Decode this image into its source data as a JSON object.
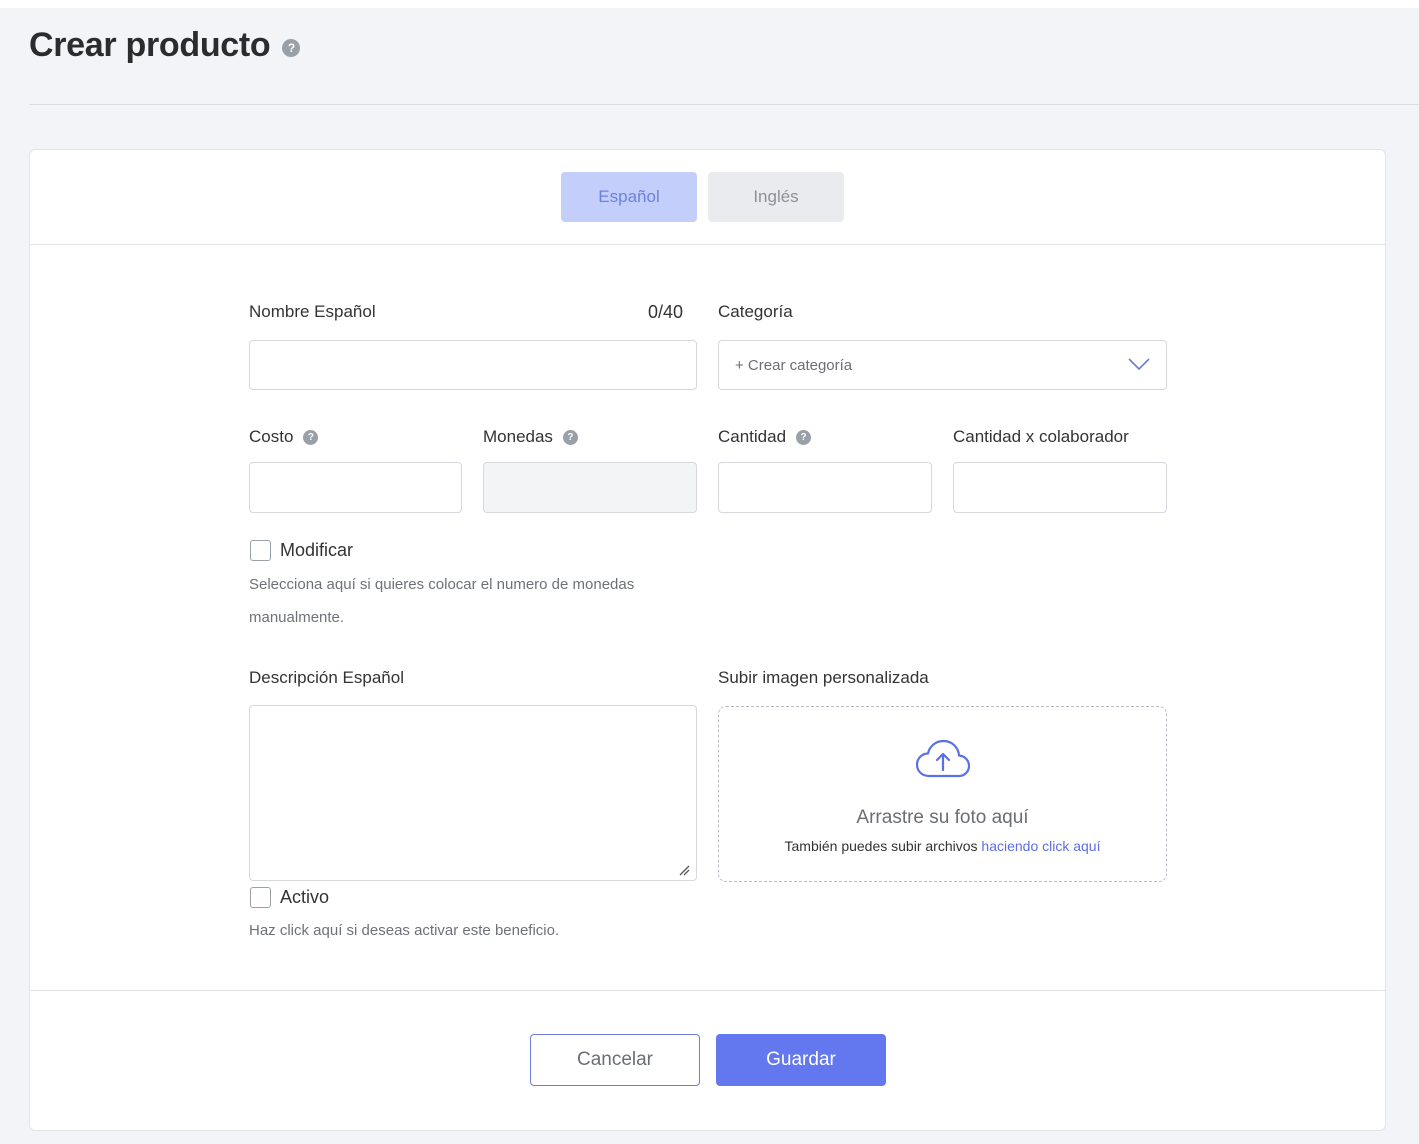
{
  "page": {
    "title": "Crear producto",
    "title_help": "?"
  },
  "tabs": [
    {
      "label": "Español",
      "active": true
    },
    {
      "label": "Inglés",
      "active": false
    }
  ],
  "form": {
    "name": {
      "label": "Nombre Español",
      "counter": "0/40",
      "value": ""
    },
    "category": {
      "label": "Categoría",
      "selected": "+ Crear categoría"
    },
    "cost": {
      "label": "Costo",
      "value": ""
    },
    "coins": {
      "label": "Monedas",
      "value": "",
      "disabled": true
    },
    "quantity": {
      "label": "Cantidad",
      "value": ""
    },
    "quantity_per_collaborator": {
      "label": "Cantidad x colaborador",
      "value": ""
    },
    "modify": {
      "label": "Modificar",
      "checked": false,
      "hint_line1": "Selecciona aquí si quieres colocar el numero de monedas",
      "hint_line2": "manualmente."
    },
    "description": {
      "label": "Descripción Español",
      "value": ""
    },
    "active": {
      "label": "Activo",
      "checked": false,
      "hint": "Haz click aquí si deseas activar este beneficio."
    },
    "upload": {
      "label": "Subir imagen personalizada",
      "title": "Arrastre su foto aquí",
      "subtitle": "También puedes subir archivos",
      "link": "haciendo click aquí"
    }
  },
  "help_glyph": "?",
  "actions": {
    "cancel": "Cancelar",
    "save": "Guardar"
  },
  "colors": {
    "primary": "#6378ef",
    "tab_active_bg": "#c4cefb",
    "tab_inactive_bg": "#e9ebee",
    "page_bg": "#f2f4f8"
  },
  "icons": {
    "help": "question-circle-icon",
    "category_dropdown": "chevron-down-icon",
    "upload": "cloud-upload-icon",
    "textarea_resize": "resize-grip-icon"
  }
}
